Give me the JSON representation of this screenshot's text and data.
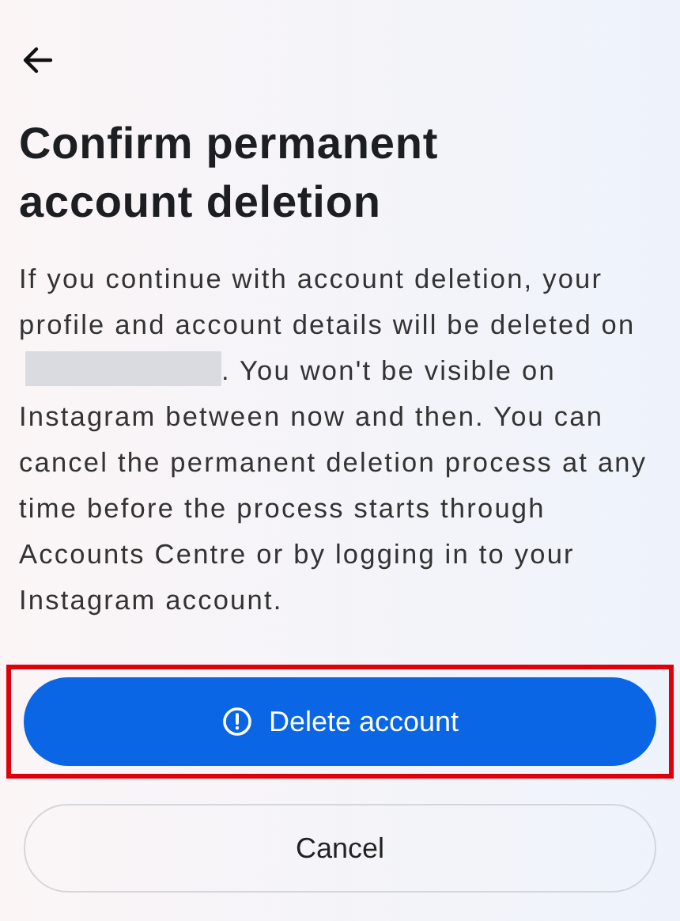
{
  "title": "Confirm permanent account deletion",
  "body": {
    "before": "If you continue with account deletion, your profile and account details will be deleted on",
    "after": ". You won't be visible on Instagram between now and then. You can cancel the permanent deletion process at any time before the process starts through Accounts Centre or by logging in to your Instagram account.",
    "redacted": true
  },
  "buttons": [
    {
      "kind": "primary",
      "label": "Delete account",
      "highlighted": true
    },
    {
      "kind": "secondary",
      "label": "Cancel",
      "highlighted": false
    }
  ]
}
